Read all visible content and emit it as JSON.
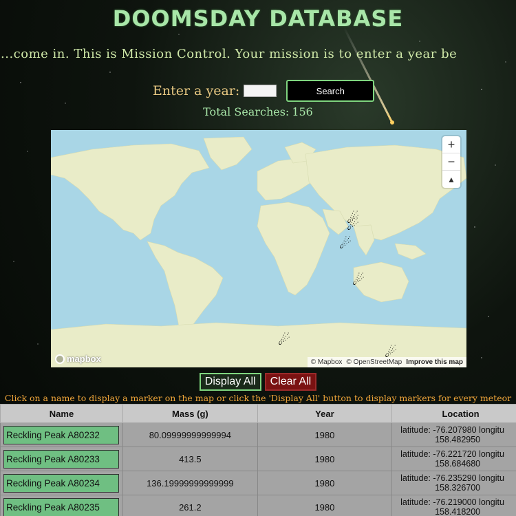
{
  "title": "DOOMSDAY DATABASE",
  "marquee": "o...come in. This is Mission Control. Your mission is to enter a year be",
  "search": {
    "label": "Enter a year:",
    "input_value": "",
    "button": "Search"
  },
  "total": {
    "label": "Total Searches:",
    "count": "156"
  },
  "map": {
    "zoom_in": "+",
    "zoom_out": "−",
    "compass": "▲",
    "logo": "mapbox",
    "attribution": {
      "mapbox": "© Mapbox",
      "osm": "© OpenStreetMap",
      "improve": "Improve this map"
    },
    "markers_icon": "meteor-icon"
  },
  "buttons": {
    "display_all": "Display All",
    "clear_all": "Clear All"
  },
  "instructions": "Click on a name to display a marker on the map or click the 'Display All' button to display markers for every meteor in the table.",
  "table": {
    "headers": {
      "name": "Name",
      "mass": "Mass (g)",
      "year": "Year",
      "location": "Location"
    },
    "rows": [
      {
        "name": "Reckling Peak A80232",
        "mass": "80.09999999999994",
        "year": "1980",
        "loc1": "latitude: -76.207980 longitu",
        "loc2": "158.482950"
      },
      {
        "name": "Reckling Peak A80233",
        "mass": "413.5",
        "year": "1980",
        "loc1": "latitude: -76.221720 longitu",
        "loc2": "158.684680"
      },
      {
        "name": "Reckling Peak A80234",
        "mass": "136.19999999999999",
        "year": "1980",
        "loc1": "latitude: -76.235290 longitu",
        "loc2": "158.326700"
      },
      {
        "name": "Reckling Peak A80235",
        "mass": "261.2",
        "year": "1980",
        "loc1": "latitude: -76.219000 longitu",
        "loc2": "158.418200"
      }
    ]
  },
  "colors": {
    "accent": "#7fd67f",
    "clear": "#7a1212",
    "water": "#a9d6e6",
    "land": "#e9ecc8",
    "instructions": "#f0a63a"
  }
}
